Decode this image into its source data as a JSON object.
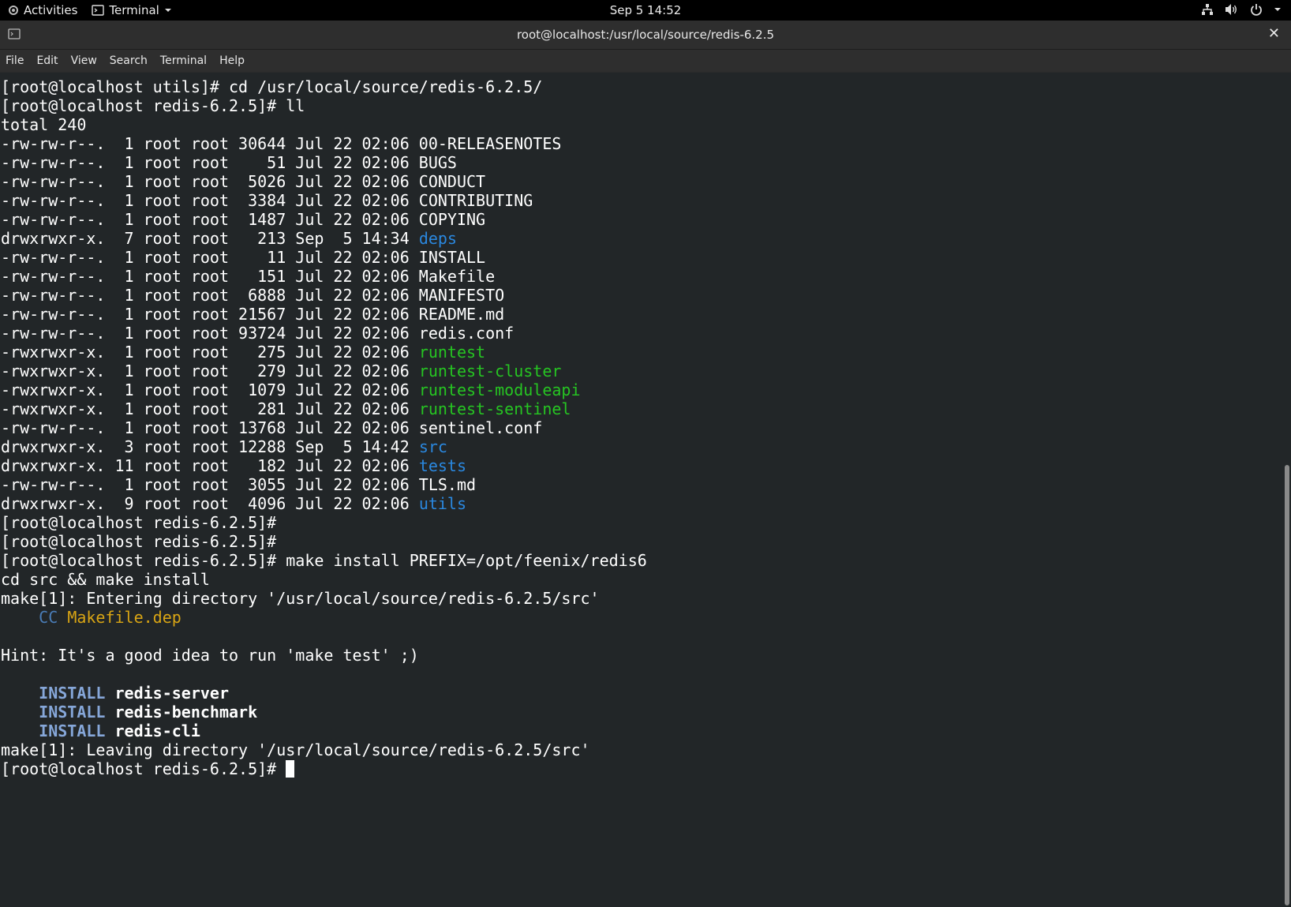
{
  "topbar": {
    "activities": "Activities",
    "app_menu": "Terminal",
    "clock": "Sep 5  14:52",
    "icons": [
      "network-icon",
      "volume-icon",
      "power-icon",
      "chevron-down-icon"
    ]
  },
  "window": {
    "title": "root@localhost:/usr/local/source/redis-6.2.5",
    "close_label": "✕"
  },
  "menus": [
    "File",
    "Edit",
    "View",
    "Search",
    "Terminal",
    "Help"
  ],
  "terminal": {
    "lines": [
      {
        "parts": [
          {
            "t": "[root@localhost utils]# cd /usr/local/source/redis-6.2.5/"
          }
        ]
      },
      {
        "parts": [
          {
            "t": "[root@localhost redis-6.2.5]# ll"
          }
        ]
      },
      {
        "parts": [
          {
            "t": "total 240"
          }
        ]
      },
      {
        "parts": [
          {
            "t": "-rw-rw-r--.  1 root root 30644 Jul 22 02:06 00-RELEASENOTES"
          }
        ]
      },
      {
        "parts": [
          {
            "t": "-rw-rw-r--.  1 root root    51 Jul 22 02:06 BUGS"
          }
        ]
      },
      {
        "parts": [
          {
            "t": "-rw-rw-r--.  1 root root  5026 Jul 22 02:06 CONDUCT"
          }
        ]
      },
      {
        "parts": [
          {
            "t": "-rw-rw-r--.  1 root root  3384 Jul 22 02:06 CONTRIBUTING"
          }
        ]
      },
      {
        "parts": [
          {
            "t": "-rw-rw-r--.  1 root root  1487 Jul 22 02:06 COPYING"
          }
        ]
      },
      {
        "parts": [
          {
            "t": "drwxrwxr-x.  7 root root   213 Sep  5 14:34 "
          },
          {
            "t": "deps",
            "c": "dir"
          }
        ]
      },
      {
        "parts": [
          {
            "t": "-rw-rw-r--.  1 root root    11 Jul 22 02:06 INSTALL"
          }
        ]
      },
      {
        "parts": [
          {
            "t": "-rw-rw-r--.  1 root root   151 Jul 22 02:06 Makefile"
          }
        ]
      },
      {
        "parts": [
          {
            "t": "-rw-rw-r--.  1 root root  6888 Jul 22 02:06 MANIFESTO"
          }
        ]
      },
      {
        "parts": [
          {
            "t": "-rw-rw-r--.  1 root root 21567 Jul 22 02:06 README.md"
          }
        ]
      },
      {
        "parts": [
          {
            "t": "-rw-rw-r--.  1 root root 93724 Jul 22 02:06 redis.conf"
          }
        ]
      },
      {
        "parts": [
          {
            "t": "-rwxrwxr-x.  1 root root   275 Jul 22 02:06 "
          },
          {
            "t": "runtest",
            "c": "exec"
          }
        ]
      },
      {
        "parts": [
          {
            "t": "-rwxrwxr-x.  1 root root   279 Jul 22 02:06 "
          },
          {
            "t": "runtest-cluster",
            "c": "exec"
          }
        ]
      },
      {
        "parts": [
          {
            "t": "-rwxrwxr-x.  1 root root  1079 Jul 22 02:06 "
          },
          {
            "t": "runtest-moduleapi",
            "c": "exec"
          }
        ]
      },
      {
        "parts": [
          {
            "t": "-rwxrwxr-x.  1 root root   281 Jul 22 02:06 "
          },
          {
            "t": "runtest-sentinel",
            "c": "exec"
          }
        ]
      },
      {
        "parts": [
          {
            "t": "-rw-rw-r--.  1 root root 13768 Jul 22 02:06 sentinel.conf"
          }
        ]
      },
      {
        "parts": [
          {
            "t": "drwxrwxr-x.  3 root root 12288 Sep  5 14:42 "
          },
          {
            "t": "src",
            "c": "dir"
          }
        ]
      },
      {
        "parts": [
          {
            "t": "drwxrwxr-x. 11 root root   182 Jul 22 02:06 "
          },
          {
            "t": "tests",
            "c": "dir"
          }
        ]
      },
      {
        "parts": [
          {
            "t": "-rw-rw-r--.  1 root root  3055 Jul 22 02:06 TLS.md"
          }
        ]
      },
      {
        "parts": [
          {
            "t": "drwxrwxr-x.  9 root root  4096 Jul 22 02:06 "
          },
          {
            "t": "utils",
            "c": "dir"
          }
        ]
      },
      {
        "parts": [
          {
            "t": "[root@localhost redis-6.2.5]#"
          }
        ]
      },
      {
        "parts": [
          {
            "t": "[root@localhost redis-6.2.5]#"
          }
        ]
      },
      {
        "parts": [
          {
            "t": "[root@localhost redis-6.2.5]# make install PREFIX=/opt/feenix/redis6"
          }
        ]
      },
      {
        "parts": [
          {
            "t": "cd src && make install"
          }
        ]
      },
      {
        "parts": [
          {
            "t": "make[1]: Entering directory '/usr/local/source/redis-6.2.5/src'"
          }
        ]
      },
      {
        "parts": [
          {
            "t": "    "
          },
          {
            "t": "CC",
            "c": "cc"
          },
          {
            "t": " "
          },
          {
            "t": "Makefile.dep",
            "c": "dep"
          }
        ]
      },
      {
        "parts": [
          {
            "t": ""
          }
        ]
      },
      {
        "parts": [
          {
            "t": "Hint: It's a good idea to run 'make test' ;)"
          }
        ]
      },
      {
        "parts": [
          {
            "t": ""
          }
        ]
      },
      {
        "parts": [
          {
            "t": "    "
          },
          {
            "t": "INSTALL",
            "c": "inst"
          },
          {
            "t": " "
          },
          {
            "t": "redis-server",
            "c": "bold"
          }
        ]
      },
      {
        "parts": [
          {
            "t": "    "
          },
          {
            "t": "INSTALL",
            "c": "inst"
          },
          {
            "t": " "
          },
          {
            "t": "redis-benchmark",
            "c": "bold"
          }
        ]
      },
      {
        "parts": [
          {
            "t": "    "
          },
          {
            "t": "INSTALL",
            "c": "inst"
          },
          {
            "t": " "
          },
          {
            "t": "redis-cli",
            "c": "bold"
          }
        ]
      },
      {
        "parts": [
          {
            "t": "make[1]: Leaving directory '/usr/local/source/redis-6.2.5/src'"
          }
        ]
      },
      {
        "parts": [
          {
            "t": "[root@localhost redis-6.2.5]# "
          }
        ],
        "cursor": true
      }
    ]
  },
  "scrollbar": {
    "thumb_start": 0.47,
    "thumb_end": 1.0
  }
}
